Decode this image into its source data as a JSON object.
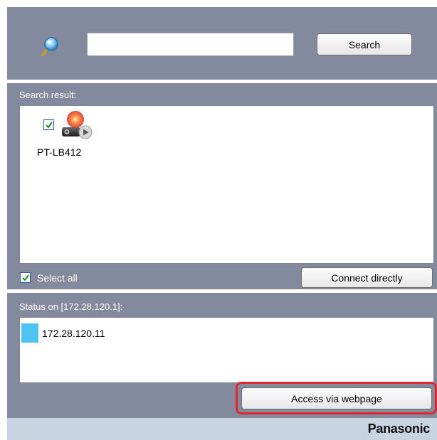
{
  "search": {
    "input_value": "",
    "button_label": "Search"
  },
  "results": {
    "header": "Search result:",
    "devices": [
      {
        "name": "PT-LB412",
        "checked": true
      }
    ],
    "select_all_label": "Select all",
    "select_all_checked": true,
    "connect_label": "Connect directly"
  },
  "status": {
    "header": "Status on [172.28.120.1]:",
    "items": [
      {
        "ip": "172.28.120.11",
        "color": "#4cc3f0"
      }
    ],
    "access_label": "Access via webpage"
  },
  "footer": {
    "brand": "Panasonic"
  },
  "colors": {
    "panel": "#848a9e",
    "footer": "#c9d4e3",
    "highlight": "#e3262d"
  },
  "icons": [
    "magnifier-icon",
    "projector-icon",
    "checkmark-icon"
  ]
}
